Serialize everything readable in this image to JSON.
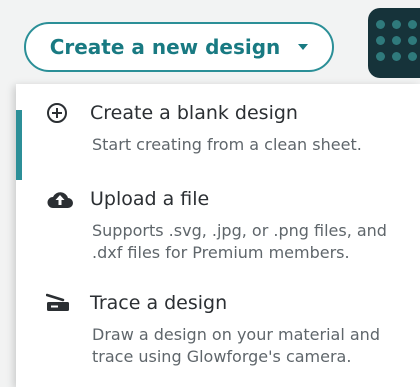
{
  "colors": {
    "accent": "#2b8f97",
    "text": "#2b2f33",
    "muted": "#5f666b"
  },
  "create_button": {
    "label": "Create a new design",
    "icon": "chevron-down-icon"
  },
  "menu": {
    "items": [
      {
        "icon": "plus-circle-icon",
        "title": "Create a blank design",
        "desc": [
          "Start creating from a clean sheet."
        ]
      },
      {
        "icon": "cloud-upload-icon",
        "title": "Upload a file",
        "desc": [
          "Supports .svg, .jpg, or .png files, and",
          ".dxf files for Premium members."
        ]
      },
      {
        "icon": "scanner-icon",
        "title": "Trace a design",
        "desc": [
          "Draw a design on your material and",
          "trace using Glowforge's camera."
        ]
      }
    ]
  }
}
